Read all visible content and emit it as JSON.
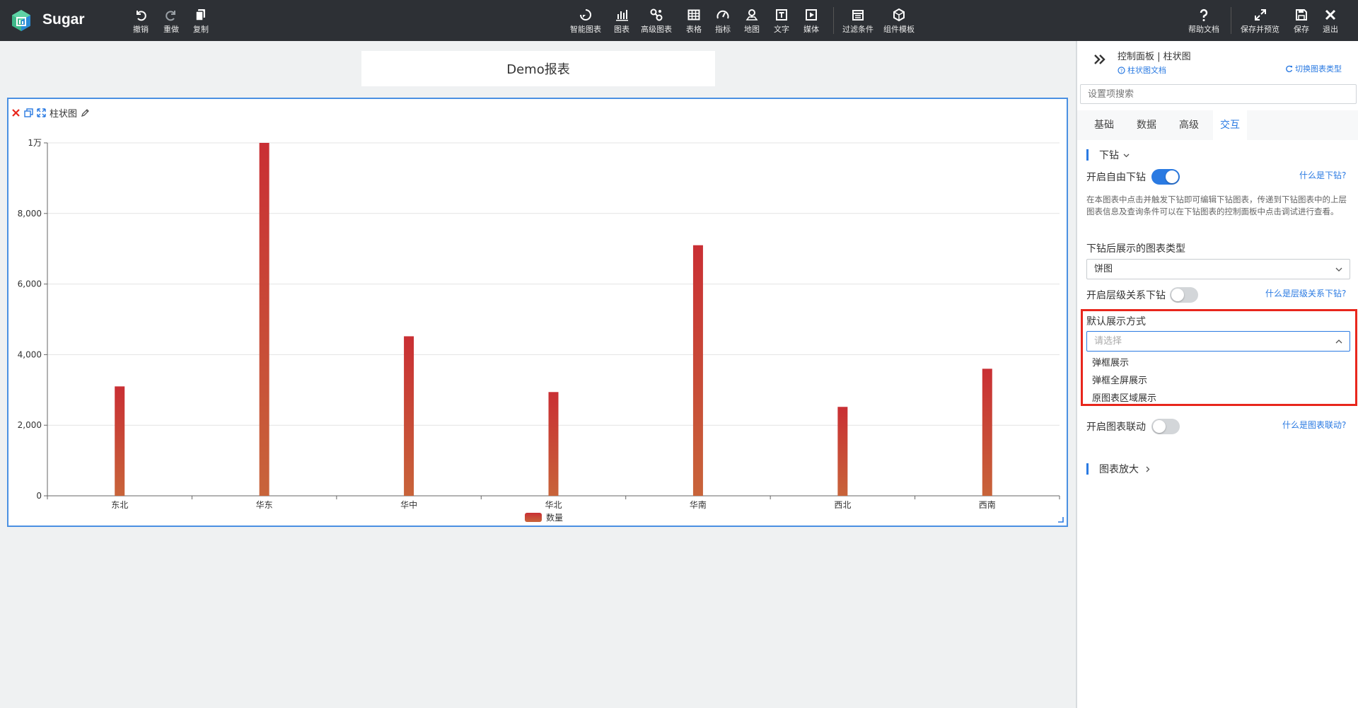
{
  "app": {
    "name": "Sugar"
  },
  "toolbar": {
    "left": [
      {
        "key": "undo",
        "label": "撤销"
      },
      {
        "key": "redo",
        "label": "重做"
      },
      {
        "key": "copy",
        "label": "复制"
      }
    ],
    "center": [
      {
        "key": "smart_chart",
        "label": "智能图表"
      },
      {
        "key": "chart",
        "label": "图表"
      },
      {
        "key": "advanced_chart",
        "label": "高级图表"
      },
      {
        "key": "table",
        "label": "表格"
      },
      {
        "key": "metric",
        "label": "指标"
      },
      {
        "key": "map",
        "label": "地图"
      },
      {
        "key": "text",
        "label": "文字"
      },
      {
        "key": "media",
        "label": "媒体"
      },
      {
        "key": "filter",
        "label": "过滤条件"
      },
      {
        "key": "template",
        "label": "组件模板"
      }
    ],
    "right": [
      {
        "key": "help",
        "label": "帮助文档"
      },
      {
        "key": "save_preview",
        "label": "保存并预览"
      },
      {
        "key": "save",
        "label": "保存"
      },
      {
        "key": "exit",
        "label": "退出"
      }
    ]
  },
  "report": {
    "title": "Demo报表"
  },
  "chart_card": {
    "title": "柱状图"
  },
  "chart_data": {
    "type": "bar",
    "categories": [
      "东北",
      "华东",
      "华中",
      "华北",
      "华南",
      "西北",
      "西南"
    ],
    "series": [
      {
        "name": "数量",
        "values": [
          3100,
          10000,
          4520,
          2940,
          7100,
          2520,
          3600
        ]
      }
    ],
    "ylim": [
      0,
      10000
    ],
    "yticks": [
      0,
      2000,
      4000,
      6000,
      8000,
      10000
    ],
    "ytick_labels": [
      "0",
      "2,000",
      "4,000",
      "6,000",
      "8,000",
      "1万"
    ],
    "grid": true,
    "legend": "bottom-center",
    "colors": {
      "bar_top": "#c92f34",
      "bar_bottom": "#c8643a"
    }
  },
  "panel": {
    "header": {
      "title": "控制面板 | 柱状图",
      "doc_link": "柱状图文档",
      "switch_link": "切换图表类型"
    },
    "search": {
      "placeholder": "设置项搜索"
    },
    "tabs": [
      {
        "label": "基础",
        "active": false
      },
      {
        "label": "数据",
        "active": false
      },
      {
        "label": "高级",
        "active": false
      },
      {
        "label": "交互",
        "active": true
      }
    ],
    "drill": {
      "section_title": "下钻",
      "free_drill_label": "开启自由下钻",
      "free_drill_on": true,
      "what_is_drill": "什么是下钻?",
      "description": "在本图表中点击并触发下钻即可编辑下钻图表，传递到下钻图表中的上层图表信息及查询条件可以在下钻图表的控制面板中点击调试进行查看。",
      "chart_type_label": "下钻后展示的图表类型",
      "chart_type_value": "饼图",
      "hier_drill_label": "开启层级关系下钻",
      "hier_drill_on": false,
      "what_is_hier": "什么是层级关系下钻?",
      "display_label": "默认展示方式",
      "display_placeholder": "请选择",
      "display_options": [
        "弹框展示",
        "弹框全屏展示",
        "原图表区域展示"
      ]
    },
    "link": {
      "label": "开启图表联动",
      "on": false,
      "what_is_link": "什么是图表联动?"
    },
    "zoom": {
      "section_title": "图表放大"
    }
  },
  "colors": {
    "accent": "#2a7ae2",
    "topbar": "#2d3035",
    "highlight": "#e8261c"
  }
}
